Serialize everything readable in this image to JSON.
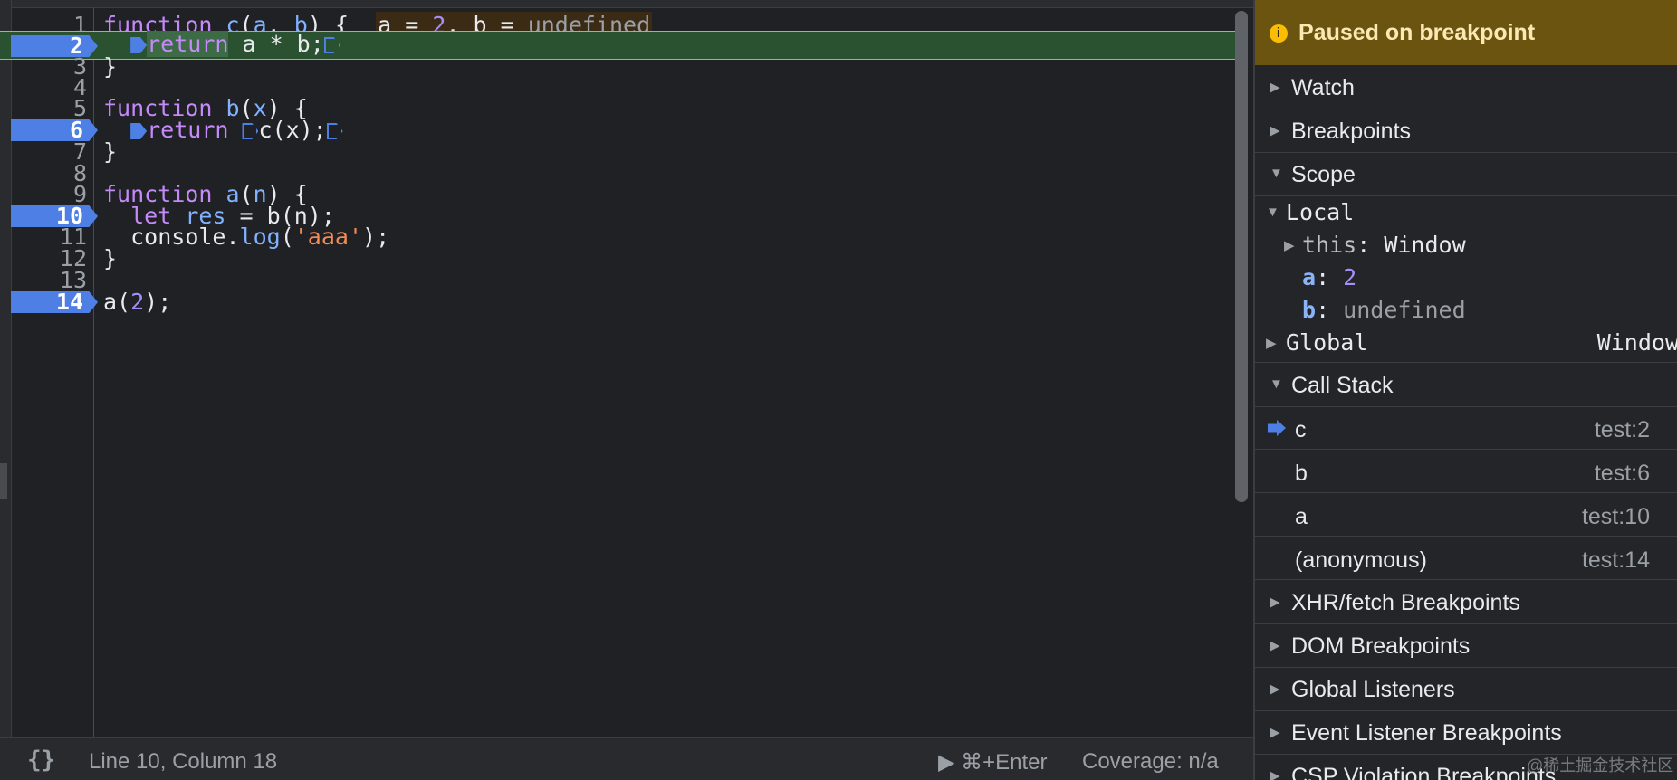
{
  "editor": {
    "lines": [
      {
        "n": "1"
      },
      {
        "n": "2"
      },
      {
        "n": "3"
      },
      {
        "n": "4"
      },
      {
        "n": "5"
      },
      {
        "n": "6"
      },
      {
        "n": "7"
      },
      {
        "n": "8"
      },
      {
        "n": "9"
      },
      {
        "n": "10"
      },
      {
        "n": "11"
      },
      {
        "n": "12"
      },
      {
        "n": "13"
      },
      {
        "n": "14"
      }
    ],
    "code": {
      "l1_kw": "function",
      "l1_name": "c",
      "l1_a": "a",
      "l1_b": "b",
      "l1_rest": ") {",
      "l1_inline_a": "a = ",
      "l1_inline_2": "2",
      "l1_inline_b": ", b = ",
      "l1_inline_undef": "undefined",
      "l2_kw": "return",
      "l2_rest": " a * b;",
      "l3": "}",
      "l5_kw": "function",
      "l5_name": "b",
      "l5_x": "x",
      "l5_rest": ") {",
      "l6_kw": "return",
      "l6_rest": "c(x);",
      "l7": "}",
      "l9_kw": "function",
      "l9_name": "a",
      "l9_n": "n",
      "l9_rest": ") {",
      "l10_kw": "let",
      "l10_var": "res",
      "l10_rest": " = b(n);",
      "l11_pre": "console.",
      "l11_fn": "log",
      "l11_str": "'aaa'",
      "l11_post": ");",
      "l12": "}",
      "l14_pre": "a(",
      "l14_num": "2",
      "l14_post": ");"
    }
  },
  "status": {
    "pretty": "{}",
    "position": "Line 10, Column 18",
    "run": "▶ ⌘+Enter",
    "coverage": "Coverage: n/a"
  },
  "sidebar": {
    "banner": "Paused on breakpoint",
    "info_icon": "i",
    "sections": {
      "watch": "Watch",
      "breakpoints": "Breakpoints",
      "scope": "Scope",
      "call_stack": "Call Stack",
      "xhr": "XHR/fetch Breakpoints",
      "dom": "DOM Breakpoints",
      "global_listeners": "Global Listeners",
      "event_listener": "Event Listener Breakpoints",
      "csp": "CSP Violation Breakpoints"
    },
    "scope": {
      "local_label": "Local",
      "this_label": "this",
      "this_value": "Window",
      "a_label": "a",
      "a_value": "2",
      "b_label": "b",
      "b_value": "undefined",
      "global_label": "Global",
      "global_value": "Window"
    },
    "call_stack": [
      {
        "name": "c",
        "loc": "test:2"
      },
      {
        "name": "b",
        "loc": "test:6"
      },
      {
        "name": "a",
        "loc": "test:10"
      },
      {
        "name": "(anonymous)",
        "loc": "test:14"
      }
    ]
  },
  "watermark": "@稀土掘金技术社区",
  "colors": {
    "breakpoint": "#4e7fe4",
    "paused_line": "#2a5231",
    "banner": "#6b5410"
  }
}
